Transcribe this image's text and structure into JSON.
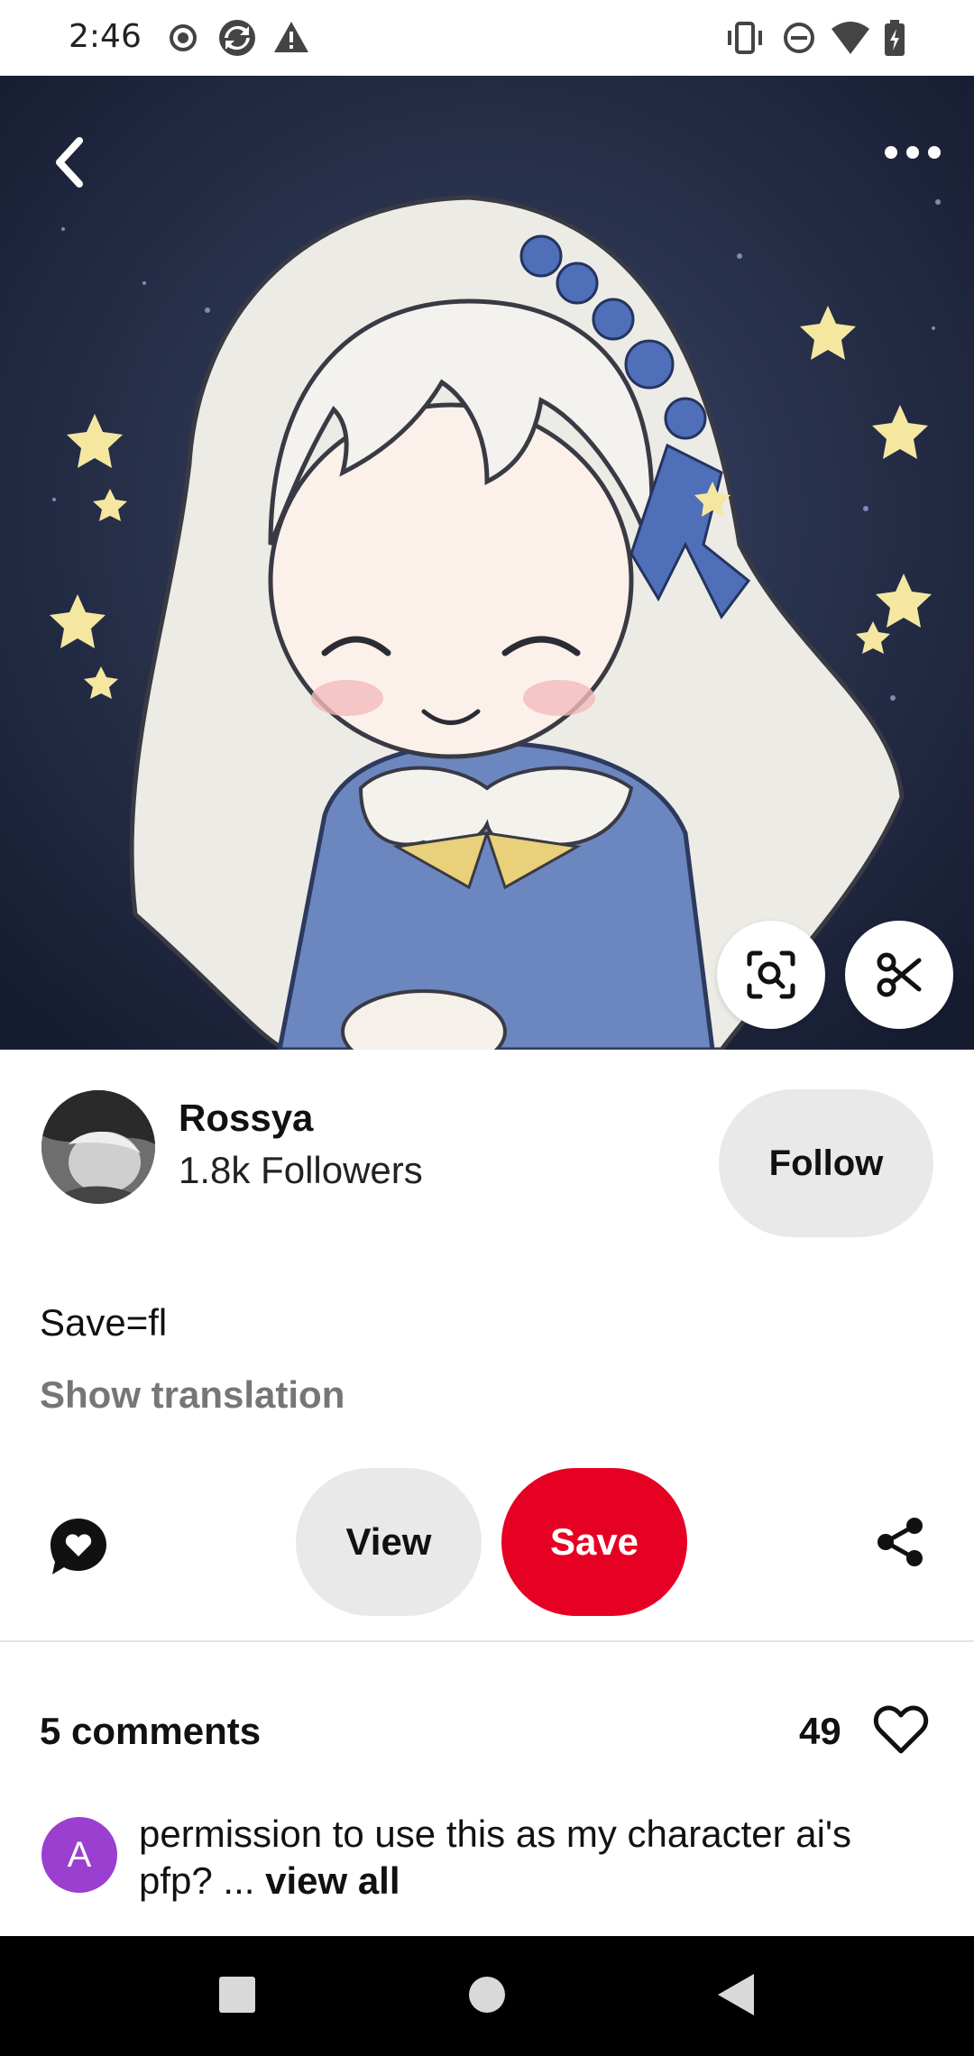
{
  "status_bar": {
    "time": "2:46",
    "left_icons": [
      "record-icon",
      "sync-icon",
      "warning-icon"
    ],
    "right_icons": [
      "vibrate-icon",
      "do-not-disturb-icon",
      "wifi-icon",
      "battery-icon"
    ]
  },
  "hero": {
    "image_alt": "Anime illustration of a smiling girl with white hair and blue star hairband on a starry background",
    "top_icons": [
      "back-icon",
      "more-icon"
    ],
    "overlay_buttons": [
      "visual-search-icon",
      "scissors-icon"
    ]
  },
  "creator": {
    "name": "Rossya",
    "followers": "1.8k Followers",
    "follow_label": "Follow"
  },
  "description": "Save=fl",
  "show_translation": "Show translation",
  "actions": {
    "view_label": "View",
    "save_label": "Save",
    "icons": [
      "comment-heart-icon",
      "share-icon"
    ]
  },
  "comments": {
    "count_label": "5 comments",
    "likes": "49",
    "first": {
      "avatar_letter": "A",
      "text": "permission to use this as my character ai's pfp? ...",
      "view_all": "view all"
    }
  },
  "nav": {
    "icons": [
      "recents-icon",
      "home-icon",
      "back-nav-icon"
    ]
  },
  "colors": {
    "save_red": "#e60023",
    "button_grey": "#e9e9e9",
    "avatar_purple": "#9b3fd1",
    "secondary_text": "#767676"
  }
}
